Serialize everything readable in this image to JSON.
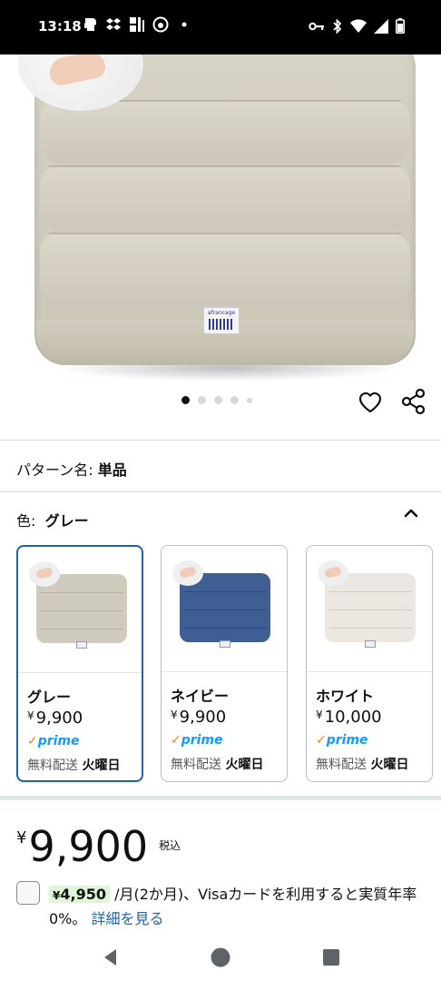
{
  "status_bar": {
    "time": "13:18",
    "left_icons": [
      "face-icon",
      "dropbox-icon",
      "barcode-icon",
      "chrome-icon",
      "dot-icon"
    ],
    "right_icons": [
      "key-icon",
      "bluetooth-icon",
      "wifi-icon",
      "signal-icon",
      "battery-icon"
    ]
  },
  "gallery": {
    "image": "gray seat cushion product photo",
    "dot_count": 5,
    "active_dot": 0,
    "tag_text": "afrancage"
  },
  "pattern": {
    "label": "パターン名:",
    "value": "単品"
  },
  "color": {
    "label": "色:",
    "value": "グレー"
  },
  "swatches": [
    {
      "name": "グレー",
      "yen": "¥",
      "price": "9,900",
      "prime": "prime",
      "ship_prefix": "無料配送",
      "ship_day": "火曜日",
      "selected": true,
      "fill": "#cfcbbd",
      "line": "#b8b3a3"
    },
    {
      "name": "ネイビー",
      "yen": "¥",
      "price": "9,900",
      "prime": "prime",
      "ship_prefix": "無料配送",
      "ship_day": "火曜日",
      "selected": false,
      "fill": "#3f5e94",
      "line": "#2f4a7a"
    },
    {
      "name": "ホワイト",
      "yen": "¥",
      "price": "10,000",
      "prime": "prime",
      "ship_prefix": "無料配送",
      "ship_day": "火曜日",
      "selected": false,
      "fill": "#ece8e1",
      "line": "#d4cfc6"
    }
  ],
  "price": {
    "yen": "¥",
    "amount": "9,900",
    "tax": "税込"
  },
  "offer": {
    "yen": "¥",
    "highlight": "4,950",
    "text": "/月(2か月)、Visaカードを利用すると実質年率0%。",
    "link": "詳細を見る"
  },
  "colors": {
    "link": "#2162a1",
    "selected_border": "#2162a1",
    "prime_blue": "#1399ff",
    "prime_check": "#f08804",
    "offer_highlight": "#dff5d8"
  },
  "navbar": {
    "icons": [
      "back-icon",
      "home-icon",
      "recents-icon"
    ]
  }
}
